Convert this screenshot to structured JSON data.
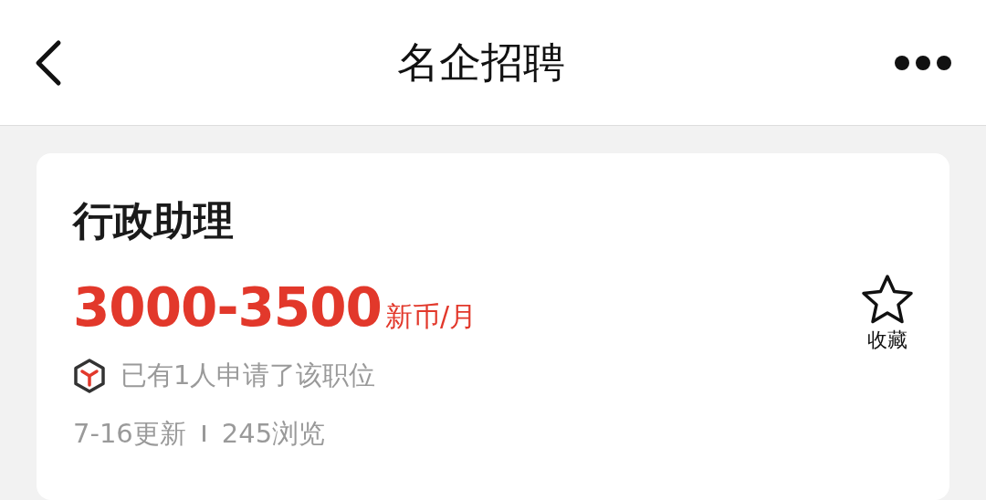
{
  "header": {
    "title": "名企招聘"
  },
  "job": {
    "title": "行政助理",
    "salary": "3000-3500",
    "salary_unit": "新币/月",
    "favorite": {
      "label": "收藏",
      "selected": false
    },
    "applicants": "已有1人申请了该职位",
    "updated": "7-16更新",
    "views": "245浏览"
  }
}
